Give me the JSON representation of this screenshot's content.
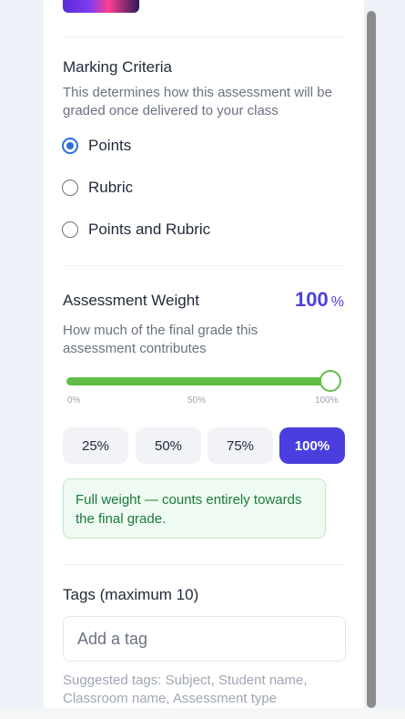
{
  "marking": {
    "title": "Marking Criteria",
    "description": "This determines how this assessment will be graded once delivered to your class",
    "options": [
      {
        "label": "Points",
        "checked": true
      },
      {
        "label": "Rubric",
        "checked": false
      },
      {
        "label": "Points and Rubric",
        "checked": false
      }
    ]
  },
  "weight": {
    "title": "Assessment Weight",
    "value": "100",
    "unit": "%",
    "description": "How much of the final grade this assessment contributes",
    "slider_value": 1.0,
    "ticks": [
      "0%",
      "50%",
      "100%"
    ],
    "presets": [
      {
        "label": "25%",
        "active": false
      },
      {
        "label": "50%",
        "active": false
      },
      {
        "label": "75%",
        "active": false
      },
      {
        "label": "100%",
        "active": true
      }
    ],
    "info": "Full weight — counts entirely towards the final grade."
  },
  "tags": {
    "title": "Tags (maximum 10)",
    "placeholder": "Add a tag",
    "value": "",
    "suggestion": "Suggested tags: Subject, Student name, Classroom name, Assessment type"
  },
  "colors": {
    "accent": "#4a3fde",
    "radio_checked": "#2f6fde",
    "slider": "#62bd47",
    "success_text": "#1c7a3c"
  }
}
